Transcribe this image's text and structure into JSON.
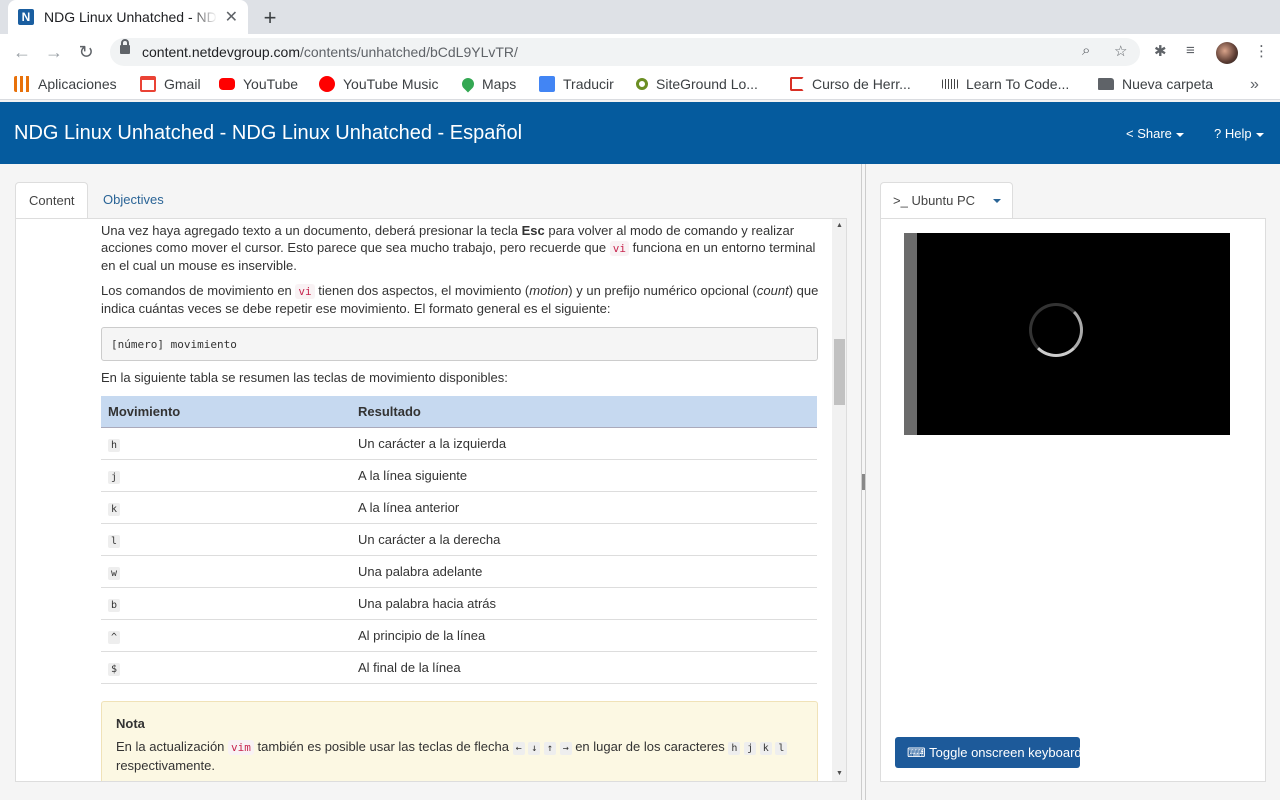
{
  "browser": {
    "tab_title": "NDG Linux Unhatched - NDG",
    "favicon_letter": "N",
    "url_host": "content.netdevgroup.com",
    "url_path": "/contents/unhatched/bCdL9YLvTR/"
  },
  "bookmarks": [
    {
      "label": "Aplicaciones",
      "icon": "apps-grid-icon",
      "color": "#e8710a"
    },
    {
      "label": "Gmail",
      "icon": "gmail-icon",
      "color": "#ea4335"
    },
    {
      "label": "YouTube",
      "icon": "youtube-icon",
      "color": "#ff0000"
    },
    {
      "label": "YouTube Music",
      "icon": "youtube-music-icon",
      "color": "#ff0000"
    },
    {
      "label": "Maps",
      "icon": "maps-icon",
      "color": "#34a853"
    },
    {
      "label": "Traducir",
      "icon": "translate-icon",
      "color": "#4285f4"
    },
    {
      "label": "SiteGround Lo...",
      "icon": "siteground-icon",
      "color": "#6b8e23"
    },
    {
      "label": "Curso de Herr...",
      "icon": "course-icon",
      "color": "#d93025"
    },
    {
      "label": "Learn To Code...",
      "icon": "cisco-icon",
      "color": "#444444"
    },
    {
      "label": "Nueva carpeta",
      "icon": "folder-icon",
      "color": "#5f6368"
    }
  ],
  "header": {
    "title": "NDG Linux Unhatched - NDG Linux Unhatched - Español",
    "share_label": "Share",
    "help_label": "Help",
    "bg_color": "#055b9e"
  },
  "left": {
    "tabs": [
      {
        "label": "Content"
      },
      {
        "label": "Objectives"
      }
    ],
    "para1": {
      "a": "Una vez haya agregado texto a un documento, deberá presionar la tecla ",
      "b": "Esc",
      "c": " para volver al modo de comando y realizar acciones como mover el cursor. Esto parece que sea mucho trabajo, pero recuerde que ",
      "d": "vi",
      "e": " funciona en un entorno terminal en el cual un mouse es inservible."
    },
    "para2": {
      "a": "Los comandos de movimiento en ",
      "b": "vi",
      "c": " tienen dos aspectos, el movimiento (",
      "d": "motion",
      "e": ") y un prefijo numérico opcional (",
      "f": "count",
      "g": ") que indica cuántas veces se debe repetir ese movimiento. El formato general es el siguiente:"
    },
    "code_block": "[número] movimiento",
    "para3": "En la siguiente tabla se resumen las teclas de movimiento disponibles:",
    "table": {
      "headers": [
        "Movimiento",
        "Resultado"
      ],
      "rows": [
        [
          "h",
          "Un carácter a la izquierda"
        ],
        [
          "j",
          "A la línea siguiente"
        ],
        [
          "k",
          "A la línea anterior"
        ],
        [
          "l",
          "Un carácter a la derecha"
        ],
        [
          "w",
          "Una palabra adelante"
        ],
        [
          "b",
          "Una palabra hacia atrás"
        ],
        [
          "^",
          "Al principio de la línea"
        ],
        [
          "$",
          "Al final de la línea"
        ]
      ]
    },
    "note": {
      "title": "Nota",
      "a": "En la actualización ",
      "b": "vim",
      "c": " también es posible usar las teclas de flecha ",
      "arrows": [
        "←",
        "↓",
        "↑",
        "→"
      ],
      "d": " en lugar de los caracteres ",
      "keys": [
        "h",
        "j",
        "k",
        "l"
      ],
      "e": " respectivamente."
    }
  },
  "right": {
    "tab_label": "Ubuntu PC",
    "tab_prefix": ">_",
    "keyboard_button": "Toggle onscreen keyboard"
  }
}
